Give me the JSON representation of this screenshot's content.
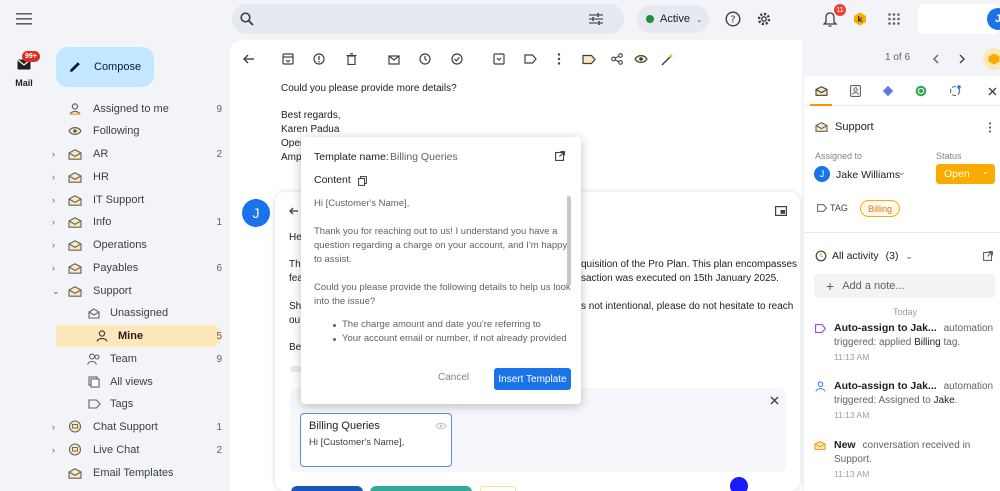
{
  "topbar": {
    "status_label": "Active",
    "notification_count": "11",
    "avatar_initial": "J"
  },
  "rail": {
    "mail_label": "Mail",
    "mail_badge": "99+"
  },
  "compose_label": "Compose",
  "sidebar": {
    "items": [
      {
        "label": "Assigned to me",
        "count": "9",
        "icon": "person-icon"
      },
      {
        "label": "Following",
        "count": "",
        "icon": "eye-icon"
      },
      {
        "label": "AR",
        "count": "2",
        "icon": "inbox-icon"
      },
      {
        "label": "HR",
        "count": "",
        "icon": "inbox-icon"
      },
      {
        "label": "IT Support",
        "count": "",
        "icon": "inbox-icon"
      },
      {
        "label": "Info",
        "count": "1",
        "icon": "inbox-icon"
      },
      {
        "label": "Operations",
        "count": "",
        "icon": "inbox-icon"
      },
      {
        "label": "Payables",
        "count": "6",
        "icon": "inbox-icon"
      },
      {
        "label": "Support",
        "count": "",
        "icon": "inbox-icon"
      },
      {
        "label": "Unassigned",
        "count": "",
        "icon": "envelope-icon"
      },
      {
        "label": "Mine",
        "count": "5",
        "icon": "person-icon"
      },
      {
        "label": "Team",
        "count": "9",
        "icon": "team-icon"
      },
      {
        "label": "All views",
        "count": "",
        "icon": "views-icon"
      },
      {
        "label": "Tags",
        "count": "",
        "icon": "tag-icon"
      },
      {
        "label": "Chat Support",
        "count": "1",
        "icon": "chat-icon"
      },
      {
        "label": "Live Chat",
        "count": "2",
        "icon": "chat-icon"
      },
      {
        "label": "Email Templates",
        "count": "",
        "icon": "template-icon"
      }
    ]
  },
  "toolbar": {
    "pager": "1 of 6"
  },
  "email": {
    "line1": "Could you please provide more details?",
    "line2": "Best regards,",
    "line3": "Karen Padua",
    "line4": "Oper",
    "line5": "Amp",
    "reply_avatar": "J",
    "reply_he": "He",
    "reply_th": "Th",
    "reply_fe": "fea",
    "reply_sh": "Sh",
    "reply_ou": "ou",
    "reply_be": "Be",
    "reply_r1": "quisition of the Pro Plan. This plan encompasses",
    "reply_r2": "saction was executed on 15th January 2025.",
    "reply_r3": "s not intentional, please do not hesitate to reach"
  },
  "template_card": {
    "title": "Billing Queries",
    "body": "Hi [Customer's Name],"
  },
  "popup": {
    "name_label": "Template name:",
    "name_value": "Billing Queries",
    "content_label": "Content",
    "lines": [
      "Hi [Customer's Name],",
      "Thank you for reaching out to us! I understand you have a",
      "question regarding a charge on your account, and I'm happy",
      "to assist.",
      "Could you please provide the following details to help us look",
      "into the issue?",
      "The charge amount and date you're referring to",
      "Your account email or number, if not already provided"
    ],
    "cancel_label": "Cancel",
    "insert_label": "Insert Template"
  },
  "right": {
    "section_title": "Support",
    "assigned_label": "Assigned to",
    "assignee": "Jake Williams",
    "assignee_initial": "J",
    "status_label": "Status",
    "status_value": "Open",
    "tag_label": "TAG",
    "tag_value": "Billing",
    "activity_label": "All activity",
    "activity_count": "(3)",
    "note_placeholder": "Add a note...",
    "today": "Today",
    "activities": [
      {
        "t1": "Auto-assign to Jak...",
        "t1b": "automation",
        "t2": "triggered: applied ",
        "t2b": "Billing",
        "t2c": " tag.",
        "time": "11:13 AM"
      },
      {
        "t1": "Auto-assign to Jak...",
        "t1b": "automation",
        "t2": "triggered: Assigned to ",
        "t2b": "Jake",
        "t2c": ".",
        "time": "11:13 AM"
      },
      {
        "t1": "New",
        "t1b": "conversation received in",
        "t2": "Support.",
        "t2b": "",
        "t2c": "",
        "time": "11:13 AM"
      }
    ]
  },
  "colors": {
    "accent": "#1a73e8",
    "status_open": "#f9ab00",
    "selected": "#fde7bb",
    "compose": "#c2e7ff"
  }
}
